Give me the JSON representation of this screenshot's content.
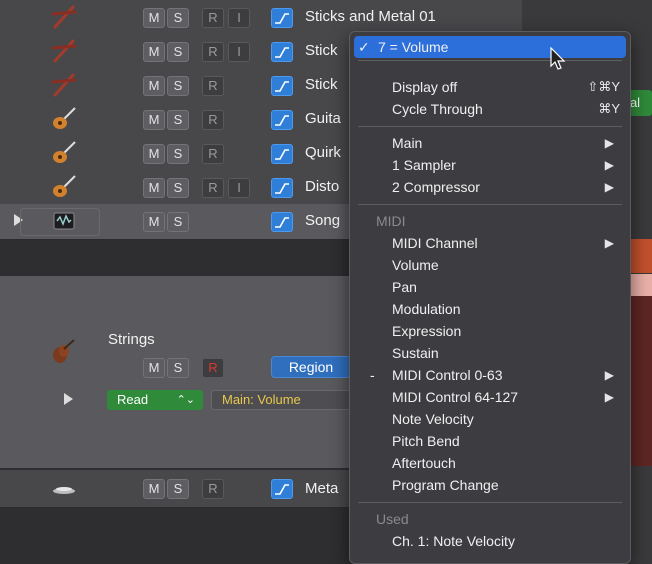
{
  "tracks": [
    {
      "name": "Sticks and Metal 01",
      "buttons": [
        "M",
        "S",
        "R",
        "I"
      ],
      "icon": "drumsticks-icon"
    },
    {
      "name": "Stick",
      "buttons": [
        "M",
        "S",
        "R",
        "I"
      ],
      "icon": "drumsticks-icon"
    },
    {
      "name": "Stick",
      "buttons": [
        "M",
        "S",
        "R"
      ],
      "icon": "drumsticks-icon"
    },
    {
      "name": "Guita",
      "buttons": [
        "M",
        "S",
        "R"
      ],
      "icon": "guitar-icon"
    },
    {
      "name": "Quirk",
      "buttons": [
        "M",
        "S",
        "R"
      ],
      "icon": "guitar-icon"
    },
    {
      "name": "Disto",
      "buttons": [
        "M",
        "S",
        "R",
        "I"
      ],
      "icon": "guitar-icon"
    },
    {
      "name": "Song",
      "buttons": [
        "M",
        "S"
      ],
      "icon": "audio-file-icon"
    }
  ],
  "strings_track": {
    "name": "Strings",
    "buttons": [
      "M",
      "S",
      "R"
    ],
    "region_label": "Region",
    "automation_mode": "Read",
    "automation_param": "Main: Volume",
    "icon": "violin-icon"
  },
  "metal_track": {
    "name": "Meta",
    "buttons": [
      "M",
      "S",
      "R"
    ],
    "icon": "metal-percussion-icon"
  },
  "right_panel": {
    "badge": "al"
  },
  "menu": {
    "selected": "7 = Volume",
    "items_top": [
      {
        "label": "Display off",
        "shortcut": "⇧⌘Y"
      },
      {
        "label": "Cycle Through",
        "shortcut": "⌘Y"
      }
    ],
    "plugins": [
      {
        "label": "Main"
      },
      {
        "label": "1 Sampler"
      },
      {
        "label": "2 Compressor"
      }
    ],
    "midi_header": "MIDI",
    "midi_items": [
      {
        "label": "MIDI Channel",
        "submenu": true
      },
      {
        "label": "Volume"
      },
      {
        "label": "Pan"
      },
      {
        "label": "Modulation"
      },
      {
        "label": "Expression"
      },
      {
        "label": "Sustain"
      },
      {
        "label": "MIDI Control 0-63",
        "submenu": true,
        "mark": "-"
      },
      {
        "label": "MIDI Control 64-127",
        "submenu": true
      },
      {
        "label": "Note Velocity"
      },
      {
        "label": "Pitch Bend"
      },
      {
        "label": "Aftertouch"
      },
      {
        "label": "Program Change"
      }
    ],
    "used_header": "Used",
    "used_items": [
      {
        "label": "Ch. 1: Note Velocity"
      }
    ]
  },
  "colors": {
    "accent": "#2c6fdb",
    "read_green": "#2f8a3a",
    "record_red": "#d83a30",
    "region_blue": "#2f6fbe"
  }
}
